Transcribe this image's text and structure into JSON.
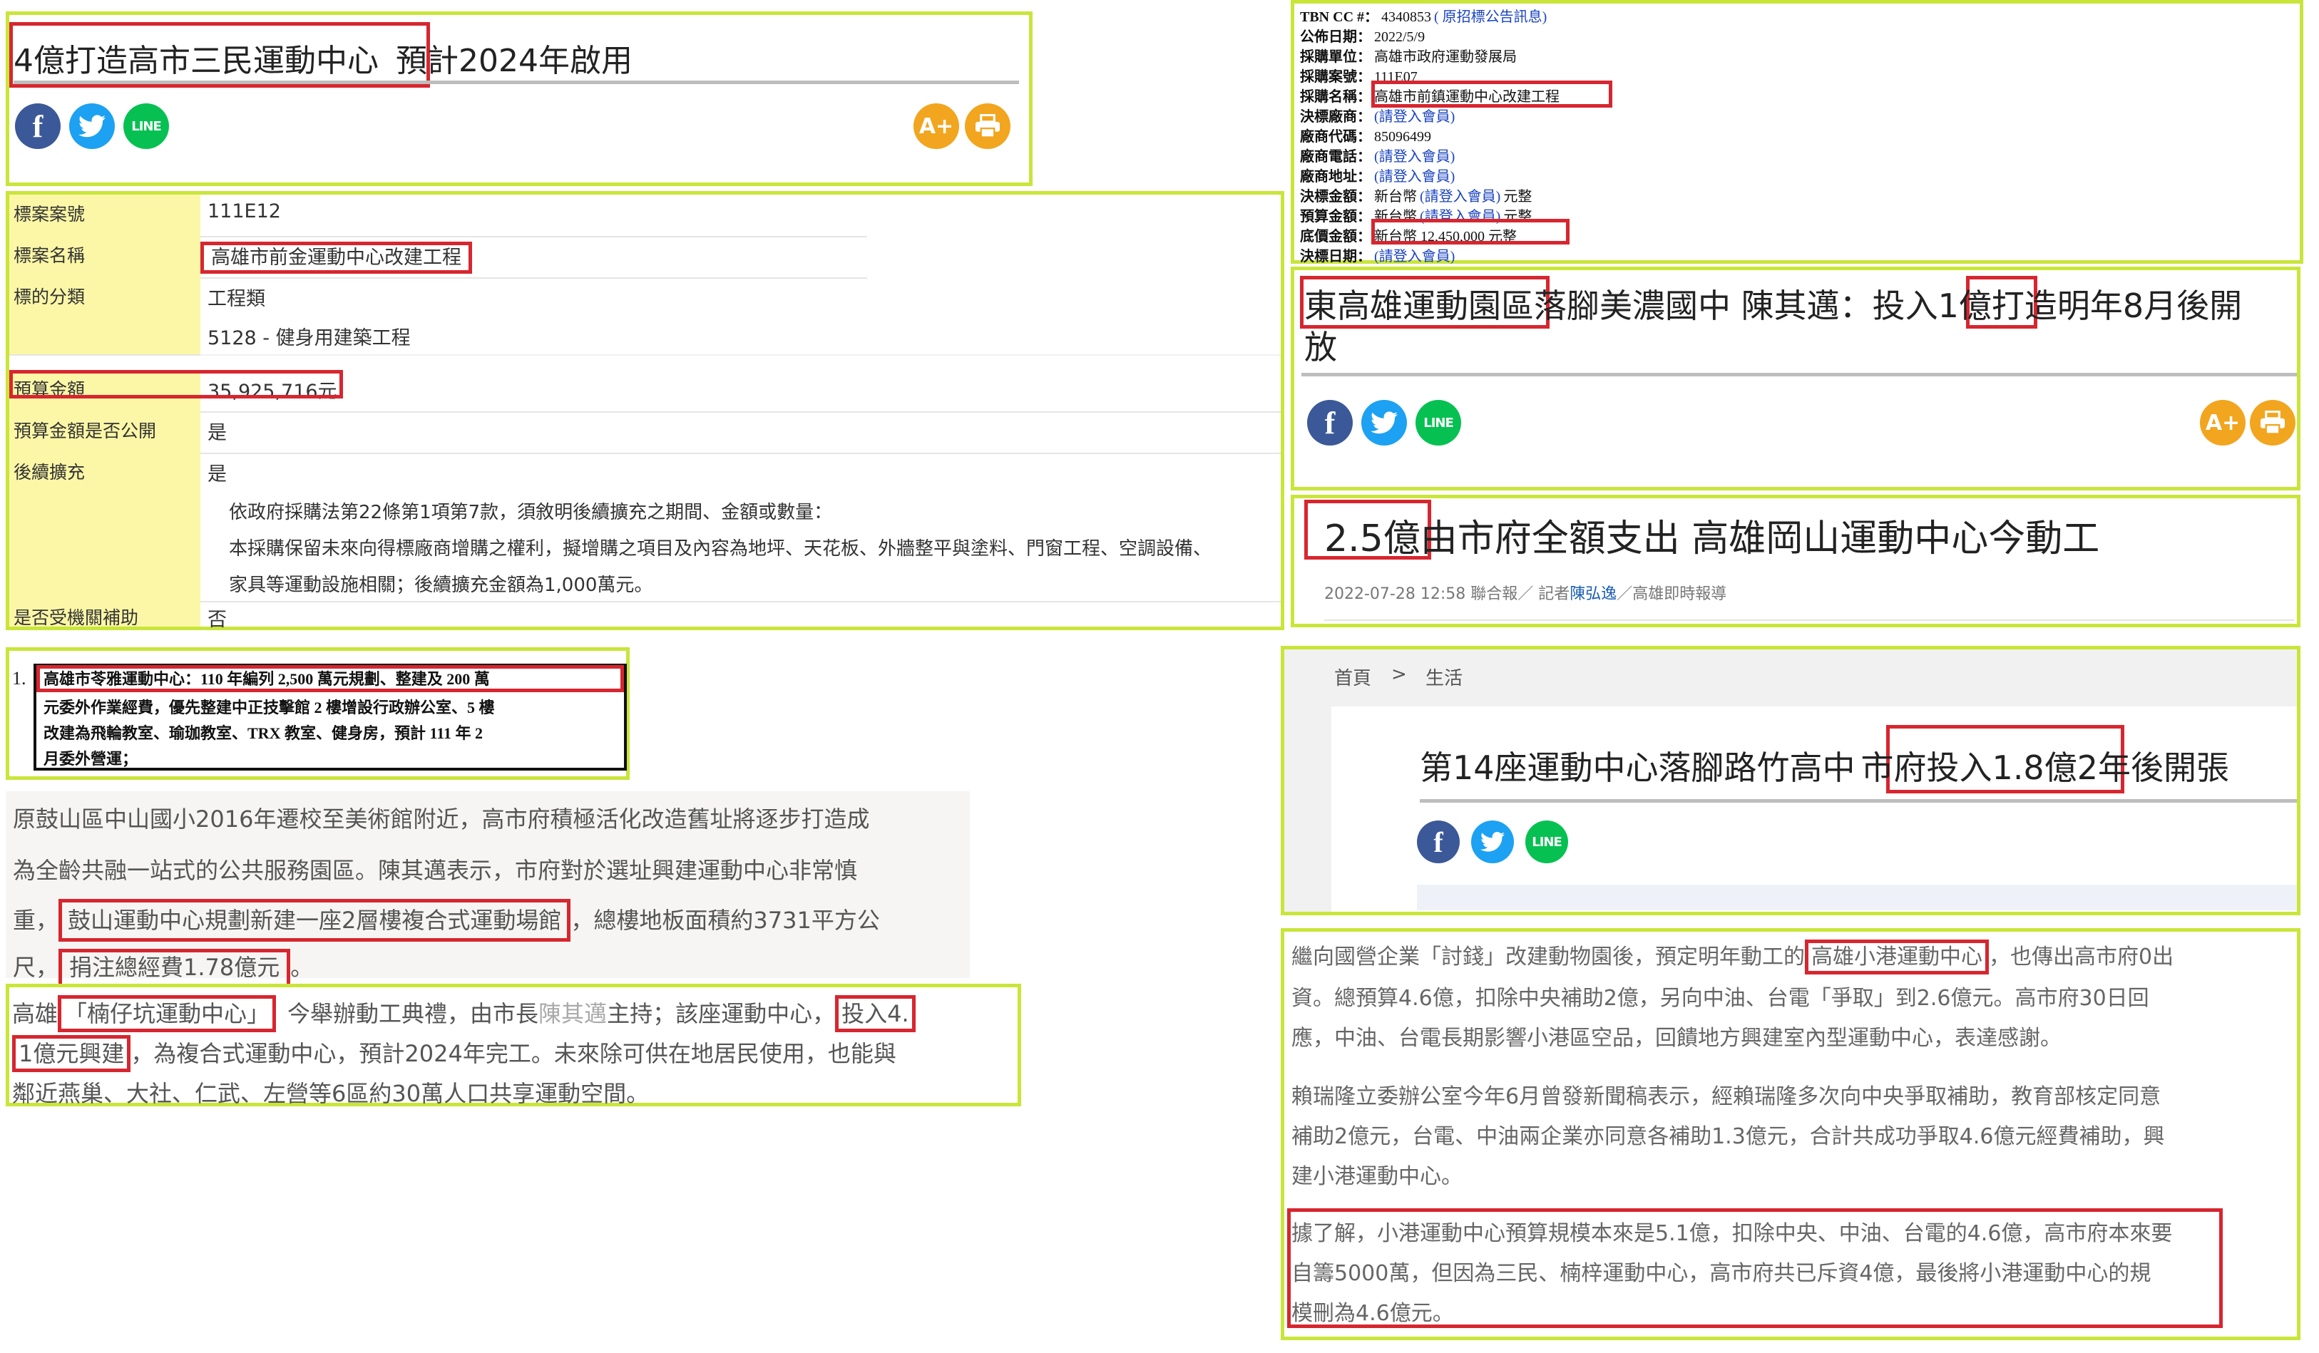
{
  "panel1": {
    "title_highlight": "4億打造高市三民運動中心",
    "title_rest": "預計2024年啟用"
  },
  "panel2": {
    "rows": [
      {
        "label": "標案案號",
        "value": "111E12"
      },
      {
        "label": "標案名稱",
        "value": "高雄市前金運動中心改建工程"
      },
      {
        "label": "標的分類",
        "value": "工程類",
        "value2": "5128 - 健身用建築工程"
      },
      {
        "label": "預算金額",
        "value": "35,925,716元"
      },
      {
        "label": "預算金額是否公開",
        "value": "是"
      },
      {
        "label": "後續擴充",
        "value": "是",
        "note1": "依政府採購法第22條第1項第7款，須敘明後續擴充之期間、金額或數量：",
        "note2": "本採購保留未來向得標廠商增購之權利，擬增購之項目及內容為地坪、天花板、外牆整平與塗料、門窗工程、空調設備、",
        "note3": "家具等運動設施相關；後續擴充金額為1,000萬元。"
      },
      {
        "label": "是否受機關補助",
        "value": "否"
      }
    ]
  },
  "panel3": {
    "num": "1.",
    "line1": "高雄市苓雅運動中心：110 年編列 2,500 萬元規劃、整建及 200 萬",
    "line2": "元委外作業經費，優先整建中正技擊館 2 樓增設行政辦公室、5 樓",
    "line3": "改建為飛輪教室、瑜珈教室、TRX 教室、健身房，預計 111 年 2",
    "line4": "月委外營運；"
  },
  "panel4": {
    "line1": "原鼓山區中山國小2016年遷校至美術館附近，高市府積極活化改造舊址將逐步打造成",
    "line2": "為全齡共融一站式的公共服務園區。陳其邁表示，市府對於選址興建運動中心非常慎",
    "line3_pre": "重，",
    "line3_hl": "鼓山運動中心規劃新建一座2層樓複合式運動場館",
    "line3_post": "，總樓地板面積約3731平方公",
    "line4_pre": "尺，",
    "line4_hl": "捐注總經費1.78億元",
    "line4_post": "。"
  },
  "panel5": {
    "line1_a": "高雄",
    "line1_hl": "「楠仔坑運動中心」",
    "line1_b": "今舉辦動工典禮，由市長",
    "line1_name": "陳其邁",
    "line1_c": "主持；該座運動中心，",
    "line1_hl2": "投入4.",
    "line2_hl": "1億元興建",
    "line2_rest": "，為複合式運動中心，預計2024年完工。未來除可供在地居民使用，也能與",
    "line3": "鄰近燕巢、大社、仁武、左營等6區約30萬人口共享運動空間。"
  },
  "panel6": {
    "rows": [
      {
        "label": "TBN CC #：",
        "value": "4340853",
        "link": "( 原招標公告訊息)"
      },
      {
        "label": "公佈日期：",
        "value": "2022/5/9"
      },
      {
        "label": "採購單位：",
        "value": "高雄市政府運動發展局"
      },
      {
        "label": "採購案號：",
        "value": "111E07"
      },
      {
        "label": "採購名稱：",
        "value": "高雄市前鎮運動中心改建工程"
      },
      {
        "label": "決標廠商：",
        "link": "(請登入會員)"
      },
      {
        "label": "廠商代碼：",
        "value": "85096499"
      },
      {
        "label": "廠商電話：",
        "link": "(請登入會員)"
      },
      {
        "label": "廠商地址：",
        "link": "(請登入會員)"
      },
      {
        "label": "決標金額：",
        "value": "新台幣",
        "link": "(請登入會員)",
        "suffix": "元整"
      },
      {
        "label": "預算金額：",
        "value": "新台幣",
        "link": "(請登入會員)",
        "suffix": "元整"
      },
      {
        "label": "底價金額：",
        "value": "新台幣 12,450,000 元整"
      },
      {
        "label": "決標日期：",
        "link": "(請登入會員)"
      }
    ]
  },
  "panel7": {
    "title_hl": "東高雄運動園區",
    "title_a": "落腳美濃國中 陳其邁：投入",
    "title_hl2": "1億",
    "title_b": "打造明年8月後開",
    "title_c": "放"
  },
  "panel8": {
    "title_hl": "2.5億",
    "title_rest": "由市府全額支出 高雄岡山運動中心今動工",
    "meta_a": "2022-07-28 12:58  聯合報／ 記者",
    "meta_name": "陳弘逸",
    "meta_b": "／高雄即時報導"
  },
  "panel9": {
    "crumb_home": "首頁",
    "crumb_sep": ">",
    "crumb_cat": "生活",
    "title_a": "第14座運動中心落腳路竹高中",
    "title_hl": "市府投入1.8億",
    "title_b": "2年後開張"
  },
  "panel10": {
    "p1_line1_a": "繼向國營企業「討錢」改建動物園後，預定明年動工的",
    "p1_line1_hl": "高雄小港運動中心",
    "p1_line1_b": "，也傳出高市府0出",
    "p1_line2": "資。總預算4.6億，扣除中央補助2億，另向中油、台電「爭取」到2.6億元。高市府30日回",
    "p1_line3": "應，中油、台電長期影響小港區空品，回饋地方興建室內型運動中心，表達感謝。",
    "p2_line1": "賴瑞隆立委辦公室今年6月曾發新聞稿表示，經賴瑞隆多次向中央爭取補助，教育部核定同意",
    "p2_line2": "補助2億元，台電、中油兩企業亦同意各補助1.3億元，合計共成功爭取4.6億元經費補助，興",
    "p2_line3": "建小港運動中心。",
    "p3_line1": "據了解，小港運動中心預算規模本來是5.1億，扣除中央、中油、台電的4.6億，高市府本來要",
    "p3_line2": "自籌5000萬，但因為三民、楠梓運動中心，高市府共已斥資4億，最後將小港運動中心的規",
    "p3_line3": "模刪為4.6億元。"
  },
  "icons": {
    "facebook": "facebook-icon",
    "twitter": "twitter-icon",
    "line": "line-icon",
    "line_text": "LINE",
    "font_size": "font-size-icon",
    "print": "print-icon",
    "font_size_glyph": "A+"
  }
}
